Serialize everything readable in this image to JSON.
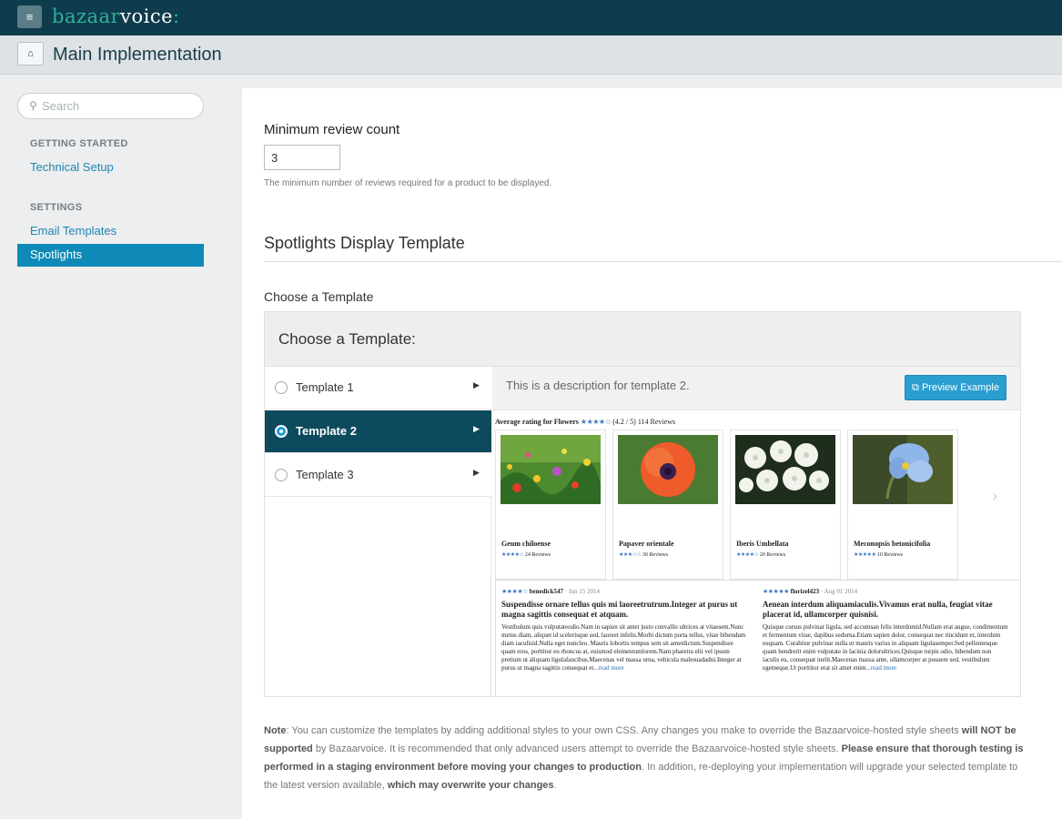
{
  "topbar": {
    "menu_icon": "≡",
    "logo_part1": "bazaar",
    "logo_part2": "voice",
    "logo_part3": ":"
  },
  "header": {
    "home_icon": "⌂",
    "title": "Main Implementation"
  },
  "sidebar": {
    "search_placeholder": "Search",
    "search_icon": "⚲",
    "section1": "GETTING STARTED",
    "link_technical": "Technical Setup",
    "section2": "SETTINGS",
    "link_email": "Email Templates",
    "link_spotlights": "Spotlights"
  },
  "form": {
    "min_label": "Minimum review count",
    "min_value": "3",
    "min_help": "The minimum number of reviews required for a product to be displayed."
  },
  "section": {
    "title": "Spotlights Display Template",
    "choose_label": "Choose a Template",
    "panel_title": "Choose a Template:",
    "templates": [
      {
        "label": "Template 1"
      },
      {
        "label": "Template 2"
      },
      {
        "label": "Template 3"
      }
    ],
    "selected_index": 1,
    "description": "This is a description for template 2.",
    "preview_button": "Preview Example",
    "preview_icon": "⧉"
  },
  "preview": {
    "avg_label": "Average rating for Flowers",
    "avg_stars": "★★★★☆",
    "avg_score": "(4.2 / 5)",
    "avg_count": "114 Reviews",
    "products": [
      {
        "name": "Geum chiloense",
        "stars": "★★★★☆",
        "reviews": "24 Reviews"
      },
      {
        "name": "Papaver orientale",
        "stars": "★★★☆☆",
        "reviews": "30 Reviews"
      },
      {
        "name": "Iberis Umbellata",
        "stars": "★★★★☆",
        "reviews": "20 Reviews"
      },
      {
        "name": "Meconopsis betonicifolia",
        "stars": "★★★★★",
        "reviews": "10 Reviews"
      }
    ],
    "reviews": [
      {
        "stars": "★★★★☆",
        "author": "benedick547",
        "date": "· Jun 15 2014",
        "title": "Suspendisse ornare tellus quis mi laoreetrutrum.Integer at purus ut magna sagittis consequat et atquam.",
        "body": "Vestibulum quis vulputateodio.Nam in sapien sit amet justo convallis ultrices at vitaesem.Nunc metus diam, aliquet id scelerisque sed, laoreet infelis.Morbi dictum porta tellus, vitae bibendum diam iaculisid.Nulla eget nuncleo. Mauris lobortis tempus sem sit ametdictum.Suspendisse quam eros, porttitor eu rhoncus at, euismod elementumlorem.Nam pharetra elit vel ipsum pretium ut aliquam ligulafaucibus.Maecenas vel massa urna, vehicula malesuadadui.Integer at purus ut magna sagittis consequat et",
        "more": "...read more"
      },
      {
        "stars": "★★★★★",
        "author": "florizel423",
        "date": "· Aug 01 2014",
        "title": "Aenean interdum aliquamiaculis.Vivamus erat nulla, feugiat vitae placerat id, ullamcorper quisnisi.",
        "body": "Quisque cursus pulvinar ligula, sed accumsan felis interdumid.Nullam erat augue, condimentum et fermentum vitae, dapibus sedurna.Etiam sapien dolor, consequat nec tincidunt et, interdum euquam. Curabitur pulvinar nulla ut mauris varius in aliquam ligulasemper.Sed pellentesque quam hendrerit enim vulputate in lacinia dolorultrices.Quisque turpis odio, bibendum non iaculis eu, consequat inelit.Maecenas massa ante, ullamcorper at posuere sed, vestibulum egetneque.Ut porttitor erat sit amet enim",
        "more": "...read more"
      }
    ],
    "next_icon": "›"
  },
  "note": {
    "p1": "Note",
    "p2": ": You can customize the templates by adding additional styles to your own CSS. Any changes you make to override the Bazaarvoice-hosted style sheets ",
    "p3": "will NOT be supported",
    "p4": " by Bazaarvoice. It is recommended that only advanced users attempt to override the Bazaarvoice-hosted style sheets. ",
    "p5": "Please ensure that thorough testing is performed in a staging environment before moving your changes to production",
    "p6": ". In addition, re-deploying your implementation will upgrade your selected template to the latest version available, ",
    "p7": "which may overwrite your changes",
    "p8": "."
  }
}
